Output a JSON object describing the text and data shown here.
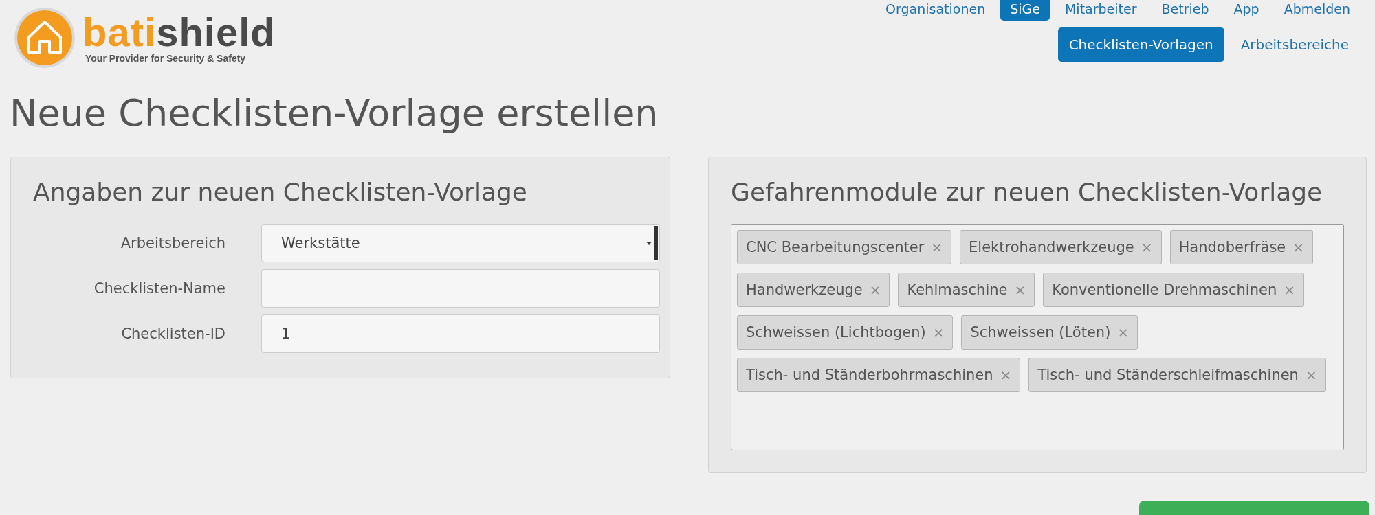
{
  "logo": {
    "name_part_1": "bati",
    "name_part_2": "shield",
    "tagline": "Your Provider for Security & Safety"
  },
  "main_nav": [
    {
      "label": "Organisationen",
      "selected": false
    },
    {
      "label": "SiGe",
      "selected": true
    },
    {
      "label": "Mitarbeiter",
      "selected": false
    },
    {
      "label": "Betrieb",
      "selected": false
    },
    {
      "label": "App",
      "selected": false
    },
    {
      "label": "Abmelden",
      "selected": false
    }
  ],
  "sub_nav": [
    {
      "label": "Checklisten-Vorlagen",
      "selected": true
    },
    {
      "label": "Arbeitsbereiche",
      "selected": false
    }
  ],
  "page_title": "Neue Checklisten-Vorlage erstellen",
  "details_panel": {
    "title": "Angaben zur neuen Checklisten-Vorlage",
    "fields": [
      {
        "kind": "select",
        "label": "Arbeitsbereich",
        "value": "Werkstätte"
      },
      {
        "kind": "text",
        "label": "Checklisten-Name"
      },
      {
        "kind": "text",
        "label": "Checklisten-ID",
        "value": "1"
      }
    ]
  },
  "modules_panel": {
    "title": "Gefahrenmodule zur neuen Checklisten-Vorlage",
    "tags": [
      {
        "label": "CNC Bearbeitungscenter",
        "remove": "×"
      },
      {
        "label": "Elektrohandwerkzeuge",
        "remove": "×"
      },
      {
        "label": "Handoberfräse",
        "remove": "×"
      },
      {
        "label": "Handwerkzeuge",
        "remove": "×"
      },
      {
        "label": "Kehlmaschine",
        "remove": "×"
      },
      {
        "label": "Konventionelle Drehmaschinen",
        "remove": "×"
      },
      {
        "label": "Schweissen (Lichtbogen)",
        "remove": "×"
      },
      {
        "label": "Schweissen (Löten)",
        "remove": "×"
      },
      {
        "label": "Tisch- und Ständerbohrmaschinen",
        "remove": "×"
      },
      {
        "label": "Tisch- und Ständerschleifmaschinen",
        "remove": "×"
      }
    ]
  }
}
